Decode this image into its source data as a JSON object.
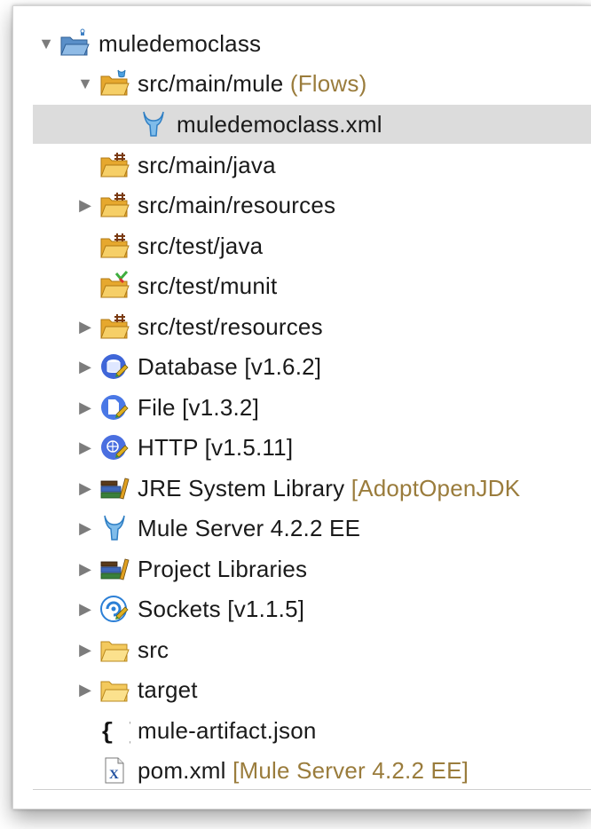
{
  "tree": [
    {
      "label": "muledemoclass",
      "decoration": "",
      "arrow": "down",
      "icon": "mule-project-icon"
    },
    {
      "label": "src/main/mule",
      "decoration": "(Flows)",
      "arrow": "down",
      "icon": "mule-source-folder-icon"
    },
    {
      "label": "muledemoclass.xml",
      "decoration": "",
      "arrow": "",
      "icon": "mule-flow-file-icon"
    },
    {
      "label": "src/main/java",
      "decoration": "",
      "arrow": "",
      "icon": "package-folder-icon"
    },
    {
      "label": "src/main/resources",
      "decoration": "",
      "arrow": "right",
      "icon": "package-folder-icon"
    },
    {
      "label": "src/test/java",
      "decoration": "",
      "arrow": "",
      "icon": "package-folder-icon"
    },
    {
      "label": "src/test/munit",
      "decoration": "",
      "arrow": "",
      "icon": "munit-folder-icon"
    },
    {
      "label": "src/test/resources",
      "decoration": "",
      "arrow": "right",
      "icon": "package-folder-icon"
    },
    {
      "label": "Database [v1.6.2]",
      "decoration": "",
      "arrow": "right",
      "icon": "database-connector-icon"
    },
    {
      "label": "File [v1.3.2]",
      "decoration": "",
      "arrow": "right",
      "icon": "file-connector-icon"
    },
    {
      "label": "HTTP [v1.5.11]",
      "decoration": "",
      "arrow": "right",
      "icon": "http-connector-icon"
    },
    {
      "label": "JRE System Library",
      "decoration": "[AdoptOpenJDK",
      "arrow": "right",
      "icon": "library-icon"
    },
    {
      "label": "Mule Server 4.2.2 EE",
      "decoration": "",
      "arrow": "right",
      "icon": "mule-runtime-icon"
    },
    {
      "label": "Project Libraries",
      "decoration": "",
      "arrow": "right",
      "icon": "library-icon"
    },
    {
      "label": "Sockets [v1.1.5]",
      "decoration": "",
      "arrow": "right",
      "icon": "sockets-connector-icon"
    },
    {
      "label": "src",
      "decoration": "",
      "arrow": "right",
      "icon": "folder-icon"
    },
    {
      "label": "target",
      "decoration": "",
      "arrow": "right",
      "icon": "folder-icon"
    },
    {
      "label": "mule-artifact.json",
      "decoration": "",
      "arrow": "",
      "icon": "json-file-icon"
    },
    {
      "label": "pom.xml",
      "decoration": "[Mule Server 4.2.2 EE]",
      "arrow": "",
      "icon": "xml-file-icon"
    }
  ],
  "selected_index": 2,
  "colors": {
    "selection": "#dcdcdc",
    "decoration": "#9a7c3c",
    "folder": "#f2c14e",
    "mule_blue": "#4a9fe0"
  }
}
